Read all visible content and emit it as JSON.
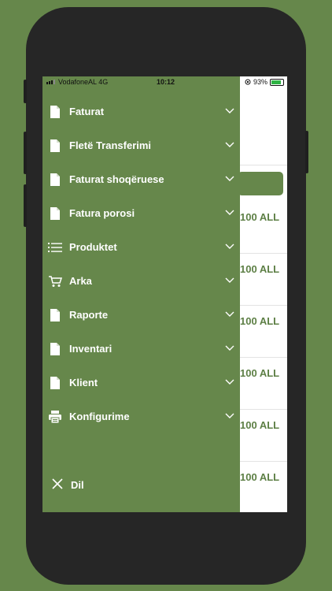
{
  "statusbar": {
    "carrier": "VodafoneAL  4G",
    "time": "10:12",
    "battery": "93%"
  },
  "menu": {
    "items": [
      {
        "label": "Faturat",
        "icon": "document-icon"
      },
      {
        "label": "Fletë Transferimi",
        "icon": "document-icon"
      },
      {
        "label": "Faturat shoqëruese",
        "icon": "document-icon"
      },
      {
        "label": "Fatura porosi",
        "icon": "document-icon"
      },
      {
        "label": "Produktet",
        "icon": "list-icon"
      },
      {
        "label": "Arka",
        "icon": "cart-icon"
      },
      {
        "label": "Raporte",
        "icon": "document-icon"
      },
      {
        "label": "Inventari",
        "icon": "document-icon"
      },
      {
        "label": "Klient",
        "icon": "document-icon"
      },
      {
        "label": "Konfigurime",
        "icon": "printer-icon"
      }
    ],
    "language_label": "Dil"
  },
  "background_list": {
    "amounts": [
      "100 ALL",
      "100 ALL",
      "100 ALL",
      "100 ALL",
      "100 ALL",
      "100 ALL"
    ]
  },
  "colors": {
    "brand_green": "#66874b",
    "phone_frame": "#262626",
    "amount_text": "#5d7f45"
  }
}
